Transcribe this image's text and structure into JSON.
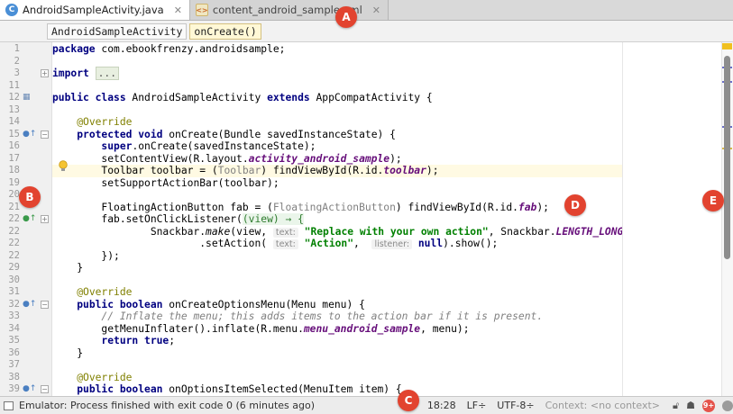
{
  "tabs": [
    {
      "label": "AndroidSampleActivity.java",
      "icon": "java-class-icon",
      "active": true
    },
    {
      "label": "content_android_sample.xml",
      "icon": "xml-file-icon",
      "active": false
    }
  ],
  "breadcrumbs": [
    "AndroidSampleActivity",
    "onCreate()"
  ],
  "line_numbers": [
    "1",
    "2",
    "3",
    "11",
    "12",
    "13",
    "14",
    "15",
    "16",
    "17",
    "18",
    "19",
    "20",
    "21",
    "22",
    "22",
    "22",
    "22",
    "29",
    "30",
    "31",
    "32",
    "33",
    "34",
    "35",
    "36",
    "37",
    "38",
    "39"
  ],
  "code": {
    "l1_a": "package ",
    "l1_b": "com.ebookfrenzy.androidsample;",
    "l3_a": "import ",
    "l3_b": "...",
    "l12_a": "public class ",
    "l12_b": "AndroidSampleActivity ",
    "l12_c": "extends ",
    "l12_d": "AppCompatActivity {",
    "override": "@Override",
    "l15_a": "protected void ",
    "l15_b": "onCreate(Bundle savedInstanceState) {",
    "l16_a": "super",
    "l16_b": ".onCreate(savedInstanceState);",
    "l17_a": "setContentView(R.layout.",
    "l17_b": "activity_android_sample",
    "l17_c": ");",
    "l18_a": "Toolbar toolbar = (",
    "l18_b": "Toolbar",
    "l18_c": ") findViewById(R.id.",
    "l18_d": "toolbar",
    "l18_e": ");",
    "l19": "setSupportActionBar(toolbar);",
    "l21_a": "FloatingActionButton fab = (",
    "l21_b": "FloatingActionButton",
    "l21_c": ") findViewById(R.id.",
    "l21_d": "fab",
    "l21_e": ");",
    "l22_a": "fab.setOnClickListener(",
    "l22_b": "(view) → {",
    "l22b_a": "Snackbar.",
    "l22b_b": "make",
    "l22b_c": "(view, ",
    "hint_text": "text:",
    "l22b_d": "\"Replace with your own action\"",
    "l22b_e": ", Snackbar.",
    "l22b_f": "LENGTH_LONG",
    "l22b_g": ")",
    "l22c_a": ".setAction( ",
    "l22c_b": "\"Action\"",
    "l22c_c": ",  ",
    "hint_listener": "listener:",
    "l22c_d": "null",
    "l22c_e": ").show();",
    "l22d": "});",
    "close_brace": "}",
    "l32_a": "public boolean ",
    "l32_b": "onCreateOptionsMenu(Menu menu) {",
    "l33": "// Inflate the menu; this adds items to the action bar if it is present.",
    "l34_a": "getMenuInflater().inflate(R.menu.",
    "l34_b": "menu_android_sample",
    "l34_c": ", menu);",
    "l35_a": "return ",
    "l35_b": "true",
    "l35_c": ";",
    "l39_a": "public boolean ",
    "l39_b": "onOptionsItemSelected(MenuItem item) {"
  },
  "status": {
    "message": "Emulator: Process finished with exit code 0 (6 minutes ago)",
    "position": "18:28",
    "line_sep": "LF÷",
    "encoding": "UTF-8÷",
    "context": "Context: <no context>",
    "badge": "9+"
  },
  "callouts": [
    "A",
    "B",
    "C",
    "D",
    "E"
  ],
  "colors": {
    "callout": "#e2432f",
    "keyword": "#000080",
    "string": "#008000",
    "annotation": "#808000",
    "field": "#660e7a"
  }
}
